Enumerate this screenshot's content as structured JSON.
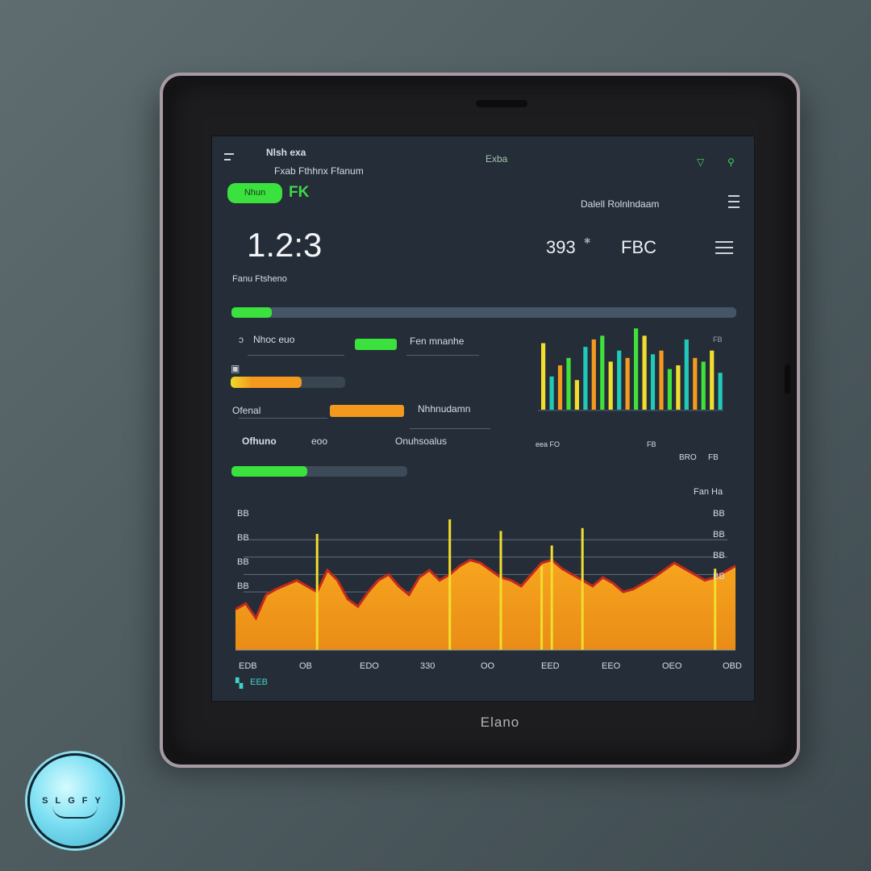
{
  "header": {
    "title_line1": "Nlsh exa",
    "title_line2": "Fxab Fthhnx Ffanum",
    "center_label": "Exba",
    "status_pill": "Nhun",
    "status_suffix": "FK"
  },
  "stats": {
    "main_value": "1.2:3",
    "main_caption": "Fanu Ftsheno",
    "value_a": "393",
    "value_b": "FBC",
    "section_title": "Dalell Rolnlndaam"
  },
  "metrics": {
    "row1_left": "Nhoc euo",
    "row1_right": "Fen mnanhe",
    "row2_left": "Ofenal",
    "row2_right": "Nhhnudamn",
    "foot_left": "Ofhuno",
    "foot_mid": "eoo",
    "foot_right": "Onuhsoalus",
    "progress_main": 0.08,
    "progress_a": 0.35,
    "progress_b": 0.62,
    "progress_c": 0.43
  },
  "top_chart": {
    "label_a": "eea FO",
    "label_b": "FB",
    "label_c": "BRO"
  },
  "main_chart": {
    "top_right_label": "Fan Ha",
    "y_left": [
      "BB",
      "BB",
      "BB",
      "BB"
    ],
    "y_right": [
      "BB",
      "BB",
      "BB",
      "BB"
    ],
    "x_ticks": [
      "EDB",
      "OB",
      "EDO",
      "330",
      "OO",
      "EED",
      "EEO",
      "OEO",
      "OBD"
    ],
    "footer": "EEB"
  },
  "device": {
    "brand": "Elano"
  },
  "watermark": {
    "text": "SLGFY"
  },
  "colors": {
    "screen_bg": "#252d39",
    "green": "#3fe13a",
    "orange": "#f39a1e",
    "yellow": "#f1dd2e",
    "teal": "#21c9b8",
    "red": "#c42a1c"
  },
  "chart_data": [
    {
      "type": "bar",
      "title": "",
      "xlabel": "",
      "ylabel": "",
      "ylim": [
        0,
        120
      ],
      "series": [
        {
          "values": [
            90,
            45,
            60,
            70,
            40,
            85,
            95,
            100,
            65,
            80,
            70,
            110,
            100,
            75,
            80,
            55,
            60,
            95,
            70,
            65,
            80,
            50
          ]
        }
      ]
    },
    {
      "type": "area",
      "title": "",
      "xlabel": "",
      "ylabel": "",
      "ylim": [
        0,
        100
      ],
      "series": [
        {
          "values": [
            28,
            32,
            22,
            38,
            42,
            45,
            48,
            44,
            40,
            55,
            48,
            35,
            30,
            40,
            48,
            52,
            44,
            38,
            50,
            55,
            48,
            52,
            58,
            62,
            60,
            55,
            50,
            48,
            44,
            52,
            60,
            62,
            56,
            52,
            48,
            44,
            50,
            46,
            40,
            42,
            46,
            50,
            55,
            60,
            56,
            52,
            48,
            50,
            54,
            58
          ]
        },
        {
          "values": [
            0,
            0,
            0,
            0,
            0,
            0,
            0,
            0,
            80,
            0,
            0,
            0,
            0,
            0,
            0,
            0,
            0,
            0,
            0,
            0,
            0,
            90,
            0,
            0,
            0,
            0,
            82,
            0,
            0,
            0,
            58,
            72,
            0,
            0,
            84,
            0,
            0,
            0,
            0,
            0,
            0,
            0,
            0,
            0,
            0,
            0,
            0,
            56,
            0,
            0
          ]
        }
      ]
    }
  ]
}
